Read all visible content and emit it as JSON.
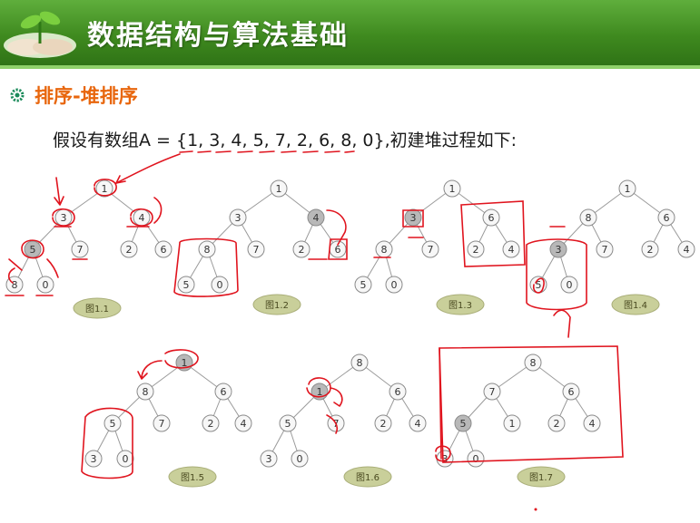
{
  "header": {
    "title": "数据结构与算法基础"
  },
  "section": {
    "subtitle": "排序-堆排序"
  },
  "description": "假设有数组A = {1, 3, 4, 5, 7, 2, 6, 8, 0},初建堆过程如下:",
  "colors": {
    "header_green": "#3f8a1f",
    "subtitle_orange": "#e8660d",
    "highlight_node": "#b8b8b8",
    "annotation_red": "#e0141e",
    "label_cloud": "#c9cf9a"
  },
  "figures": [
    {
      "label": "图1.1",
      "nodes": [
        "1",
        "3",
        "4",
        "5",
        "7",
        "2",
        "6",
        "8",
        "0"
      ],
      "highlight": "5"
    },
    {
      "label": "图1.2",
      "nodes": [
        "1",
        "3",
        "4",
        "8",
        "7",
        "2",
        "6",
        "5",
        "0"
      ],
      "highlight": "4"
    },
    {
      "label": "图1.3",
      "nodes": [
        "1",
        "3",
        "6",
        "8",
        "7",
        "2",
        "4",
        "5",
        "0"
      ],
      "highlight": "3"
    },
    {
      "label": "图1.4",
      "nodes": [
        "1",
        "8",
        "6",
        "3",
        "7",
        "2",
        "4",
        "5",
        "0"
      ],
      "highlight": "3"
    },
    {
      "label": "图1.5",
      "nodes": [
        "1",
        "8",
        "6",
        "5",
        "7",
        "2",
        "4",
        "3",
        "0"
      ],
      "highlight": "1"
    },
    {
      "label": "图1.6",
      "nodes": [
        "8",
        "1",
        "6",
        "5",
        "7",
        "2",
        "4",
        "3",
        "0"
      ],
      "highlight": "1"
    },
    {
      "label": "图1.7",
      "nodes": [
        "8",
        "7",
        "6",
        "5",
        "1",
        "2",
        "4",
        "3",
        "0"
      ],
      "highlight": "5"
    }
  ]
}
